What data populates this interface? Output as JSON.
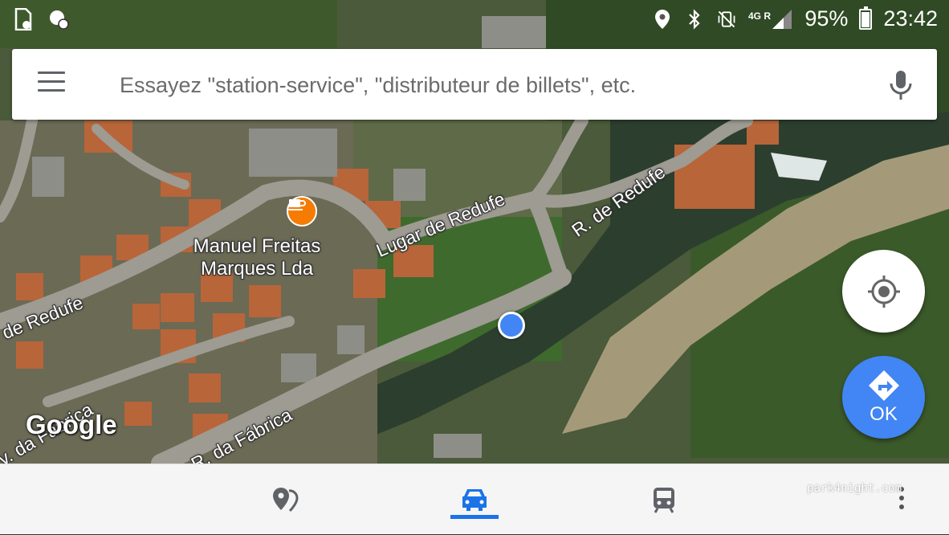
{
  "status_bar": {
    "battery_percent": "95%",
    "time": "23:42",
    "network": "4G R",
    "icons": [
      "sim-card-icon",
      "data-saver-icon",
      "location-icon",
      "bluetooth-icon",
      "vibrate-mute-icon",
      "signal-icon",
      "battery-icon"
    ]
  },
  "search": {
    "placeholder": "Essayez \"station-service\", \"distributeur de billets\", etc."
  },
  "map": {
    "poi_name": "Manuel Freitas Marques Lda",
    "poi_line1": "Manuel Freitas",
    "poi_line2": "Marques Lda",
    "poi_icon": "cafe-icon",
    "streets": {
      "lugar": "Lugar de Redufe",
      "r_redufe": "R. de Redufe",
      "de_redufe": "de Redufe",
      "r_fabrica": "R. da Fábrica",
      "v_fabrica": "v. da Fábrica"
    },
    "logo": "Google"
  },
  "fabs": {
    "go_label": "OK"
  },
  "bottom_nav": {
    "tabs": [
      "explore",
      "driving",
      "transit"
    ],
    "active": "driving",
    "accent": "#1a73e8"
  },
  "watermark": "park4night.com",
  "colors": {
    "user_dot": "#4285f4",
    "poi": "#f57c00"
  }
}
